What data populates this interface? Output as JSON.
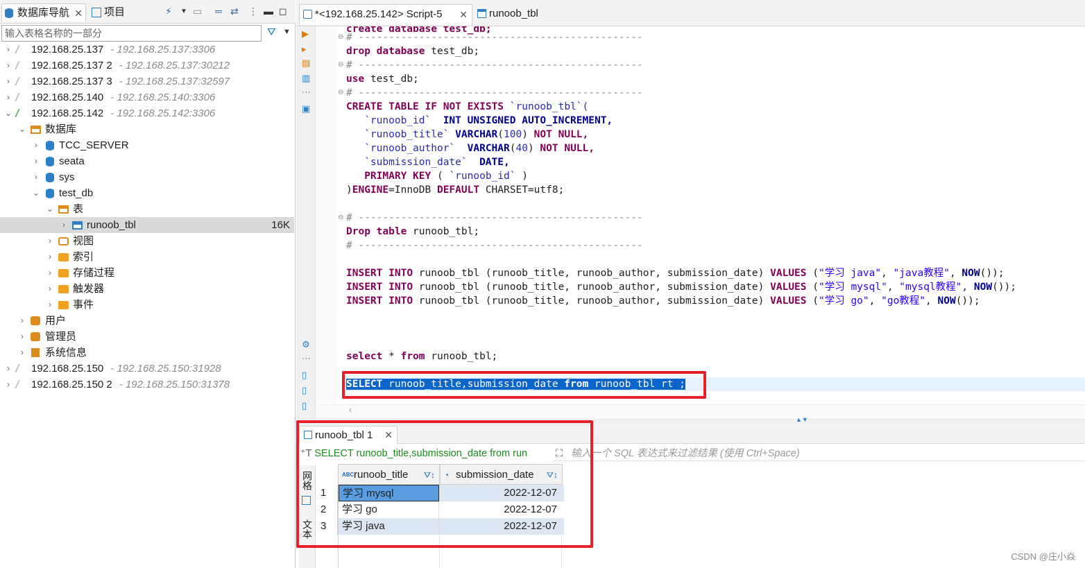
{
  "left_panel": {
    "tabs": {
      "navigator": "数据库导航",
      "projects": "项目"
    },
    "filter_placeholder": "输入表格名称的一部分",
    "tree": [
      {
        "label": "192.168.25.137",
        "sub": "- 192.168.25.137:3306"
      },
      {
        "label": "192.168.25.137 2",
        "sub": "- 192.168.25.137:30212"
      },
      {
        "label": "192.168.25.137 3",
        "sub": "- 192.168.25.137:32597"
      },
      {
        "label": "192.168.25.140",
        "sub": "- 192.168.25.140:3306"
      },
      {
        "label": "192.168.25.142",
        "sub": "- 192.168.25.142:3306"
      },
      {
        "label": "数据库"
      },
      {
        "label": "TCC_SERVER"
      },
      {
        "label": "seata"
      },
      {
        "label": "sys"
      },
      {
        "label": "test_db"
      },
      {
        "label": "表"
      },
      {
        "label": "runoob_tbl",
        "size": "16K"
      },
      {
        "label": "视图"
      },
      {
        "label": "索引"
      },
      {
        "label": "存储过程"
      },
      {
        "label": "触发器"
      },
      {
        "label": "事件"
      },
      {
        "label": "用户"
      },
      {
        "label": "管理员"
      },
      {
        "label": "系统信息"
      },
      {
        "label": "192.168.25.150",
        "sub": "- 192.168.25.150:31928"
      },
      {
        "label": "192.168.25.150 2",
        "sub": "- 192.168.25.150:31378"
      }
    ]
  },
  "editor": {
    "tabs": {
      "script": "*<192.168.25.142> Script-5",
      "table": "runoob_tbl"
    },
    "code": {
      "l0": "create database test_db;",
      "sep": "# -----------------------------------------------",
      "drop_db": [
        "drop",
        "database",
        "test_db;"
      ],
      "use_db": [
        "use",
        "test_db;"
      ],
      "create": {
        "head": [
          "CREATE",
          "TABLE",
          "IF",
          "NOT",
          "EXISTS",
          "`runoob_tbl`("
        ],
        "c1": [
          "`runoob_id`",
          "INT",
          "UNSIGNED",
          "AUTO_INCREMENT,"
        ],
        "c2": [
          "`runoob_title`",
          "VARCHAR",
          "(",
          "100",
          ")",
          "NOT",
          "NULL,"
        ],
        "c3": [
          "`runoob_author`",
          "VARCHAR",
          "(",
          "40",
          ")",
          "NOT",
          "NULL,"
        ],
        "c4": [
          "`submission_date`",
          "DATE,"
        ],
        "c5": [
          "PRIMARY",
          "KEY",
          "(",
          "`runoob_id`",
          ")"
        ],
        "tail": [
          ")",
          "ENGINE",
          "=InnoDB",
          "DEFAULT",
          "CHARSET=utf8;"
        ]
      },
      "drop_tbl": [
        "Drop",
        "table",
        "runoob_tbl;"
      ],
      "inserts": [
        {
          "kw1": "INSERT",
          "kw2": "INTO",
          "mid": "runoob_tbl (runoob_title, runoob_author, submission_date)",
          "kw3": "VALUES",
          "open": "(",
          "v1": "\"学习 java\"",
          "comma": ",",
          "v2": "\"java教程\"",
          "fn": "NOW",
          "close": "());"
        },
        {
          "kw1": "INSERT",
          "kw2": "INTO",
          "mid": "runoob_tbl (runoob_title, runoob_author, submission_date)",
          "kw3": "VALUES",
          "open": "(",
          "v1": "\"学习 mysql\"",
          "comma": ",",
          "v2": "\"mysql教程\"",
          "fn": "NOW",
          "close": "());"
        },
        {
          "kw1": "INSERT",
          "kw2": "INTO",
          "mid": "runoob_tbl (runoob_title, runoob_author, submission_date)",
          "kw3": "VALUES",
          "open": "(",
          "v1": "\"学习 go\"",
          "comma": ",",
          "v2": "\"go教程\"",
          "fn": "NOW",
          "close": "());"
        }
      ],
      "select_all": [
        "select",
        "*",
        "from",
        "runoob_tbl;"
      ],
      "select_sel": [
        "SELECT",
        "runoob_title,submission_date",
        "from",
        "runoob_tbl rt ;"
      ]
    }
  },
  "results": {
    "tab_label": "runoob_tbl 1",
    "query_text": "SELECT runoob_title,submission_date from run",
    "filter_placeholder": "输入一个 SQL 表达式来过滤结果 (使用 Ctrl+Space)",
    "side_tabs": {
      "grid": "网格",
      "text": "文本"
    },
    "columns": [
      {
        "name": "runoob_title",
        "type_badge": "ABC"
      },
      {
        "name": "submission_date"
      }
    ],
    "rows": [
      {
        "n": "1",
        "title": "学习 mysql",
        "date": "2022-12-07"
      },
      {
        "n": "2",
        "title": "学习 go",
        "date": "2022-12-07"
      },
      {
        "n": "3",
        "title": "学习 java",
        "date": "2022-12-07"
      }
    ]
  },
  "watermark": "CSDN @庄小焱",
  "colors": {
    "keyword": "#7f0055",
    "selection": "#0b64c9",
    "annotation": "#e8202a",
    "alt_row": "#dce7f3"
  }
}
